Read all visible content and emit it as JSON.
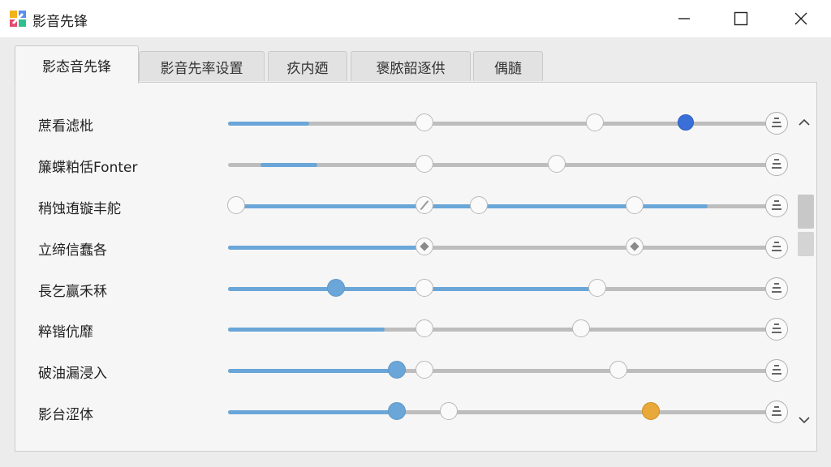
{
  "window": {
    "title": "影音先锋",
    "icon": "app-logo-icon",
    "controls": [
      "minimize-icon",
      "maximize-icon",
      "close-icon"
    ]
  },
  "tabs": [
    {
      "label": "影态音先锋",
      "active": true
    },
    {
      "label": "影音先率设置",
      "active": false
    },
    {
      "label": "疚内廼",
      "active": false
    },
    {
      "label": "褒脓韶逐供",
      "active": false
    },
    {
      "label": "偶膸",
      "active": false
    }
  ],
  "rows": [
    {
      "label": "蔗看滤枇",
      "fill_start": 0,
      "fill_end": 0.15,
      "knobs": [
        {
          "pos": 0.365,
          "style": "plain"
        },
        {
          "pos": 0.68,
          "style": "plain"
        },
        {
          "pos": 0.85,
          "style": "dark"
        }
      ]
    },
    {
      "label": "簾蝶粕佸Fonter",
      "fill_start": 0.06,
      "fill_end": 0.165,
      "knobs": [
        {
          "pos": 0.365,
          "style": "plain"
        },
        {
          "pos": 0.61,
          "style": "plain"
        }
      ]
    },
    {
      "label": "稍蚀迶镟丰舵",
      "fill_start": 0,
      "fill_end": 0.89,
      "knobs": [
        {
          "pos": 0.015,
          "style": "plain"
        },
        {
          "pos": 0.365,
          "style": "slash"
        },
        {
          "pos": 0.465,
          "style": "plain"
        },
        {
          "pos": 0.755,
          "style": "plain"
        }
      ]
    },
    {
      "label": "立缔信蠢各",
      "fill_start": 0,
      "fill_end": 0.365,
      "knobs": [
        {
          "pos": 0.365,
          "style": "diamond"
        },
        {
          "pos": 0.755,
          "style": "diamond"
        }
      ]
    },
    {
      "label": "長乞赢禾秝",
      "fill_start": 0,
      "fill_end": 0.685,
      "knobs": [
        {
          "pos": 0.2,
          "style": "blue"
        },
        {
          "pos": 0.365,
          "style": "plain"
        },
        {
          "pos": 0.685,
          "style": "plain"
        }
      ]
    },
    {
      "label": "粹锴伉靡",
      "fill_start": 0,
      "fill_end": 0.29,
      "knobs": [
        {
          "pos": 0.365,
          "style": "plain"
        },
        {
          "pos": 0.655,
          "style": "plain"
        }
      ]
    },
    {
      "label": "破油漏浸入",
      "fill_start": 0,
      "fill_end": 0.315,
      "knobs": [
        {
          "pos": 0.313,
          "style": "blue"
        },
        {
          "pos": 0.365,
          "style": "plain"
        },
        {
          "pos": 0.725,
          "style": "plain"
        }
      ]
    },
    {
      "label": "影台涩体",
      "fill_start": 0,
      "fill_end": 0.315,
      "knobs": [
        {
          "pos": 0.313,
          "style": "blue"
        },
        {
          "pos": 0.41,
          "style": "plain"
        },
        {
          "pos": 0.785,
          "style": "orange"
        }
      ]
    }
  ],
  "colors": {
    "fill": "#6aa6d8",
    "track": "#bdbdbd",
    "accent": "#3a6fd8",
    "orange": "#e8a93a"
  }
}
